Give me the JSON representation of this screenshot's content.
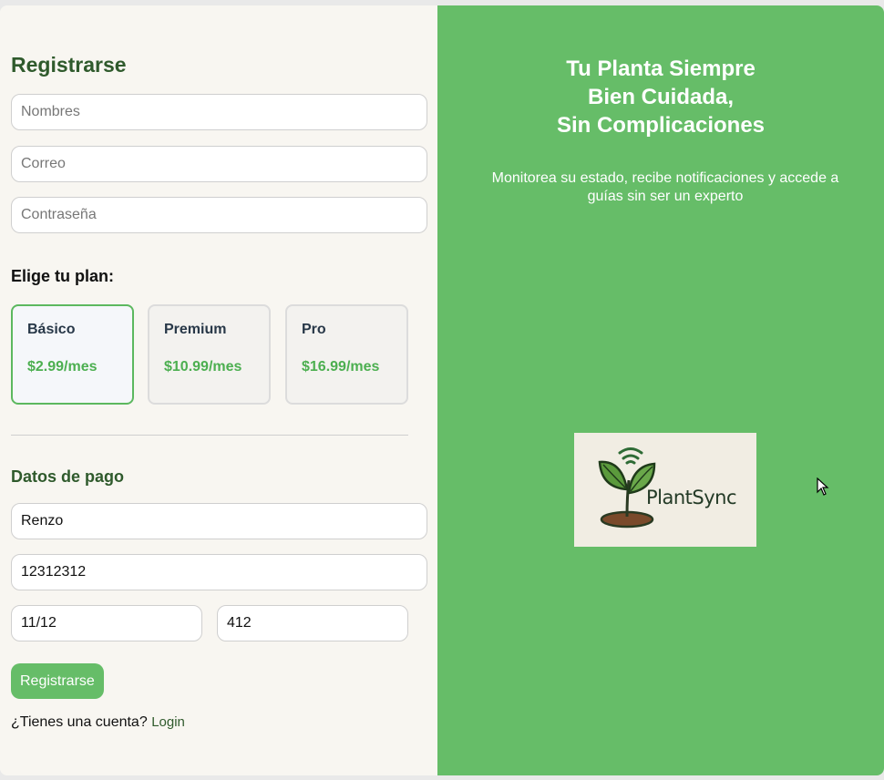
{
  "form": {
    "title": "Registrarse",
    "name_placeholder": "Nombres",
    "email_placeholder": "Correo",
    "password_placeholder": "Contraseña"
  },
  "plans": {
    "title": "Elige tu plan:",
    "items": [
      {
        "name": "Básico",
        "price": "$2.99/mes",
        "selected": true
      },
      {
        "name": "Premium",
        "price": "$10.99/mes",
        "selected": false
      },
      {
        "name": "Pro",
        "price": "$16.99/mes",
        "selected": false
      }
    ]
  },
  "payment": {
    "title": "Datos de pago",
    "cardholder_value": "Renzo",
    "card_number_value": "12312312",
    "expiry_value": "11/12",
    "cvv_value": "412"
  },
  "actions": {
    "submit_label": "Registrarse",
    "have_account_text": "¿Tienes una cuenta?",
    "login_label": "Login"
  },
  "hero": {
    "title_lines": [
      "Tu Planta Siempre",
      "Bien Cuidada,",
      "Sin Complicaciones"
    ],
    "subtitle": "Monitorea su estado, recibe notificaciones y accede a guías sin ser un experto",
    "logo_text": "PlantSync"
  },
  "colors": {
    "brand_green": "#66bd68",
    "dark_green": "#2f5a2c",
    "price_green": "#4caf50",
    "panel_bg": "#f8f6f1"
  },
  "icons": {
    "logo": "plant-sprout-wifi-icon",
    "cursor": "mouse-pointer-icon"
  }
}
